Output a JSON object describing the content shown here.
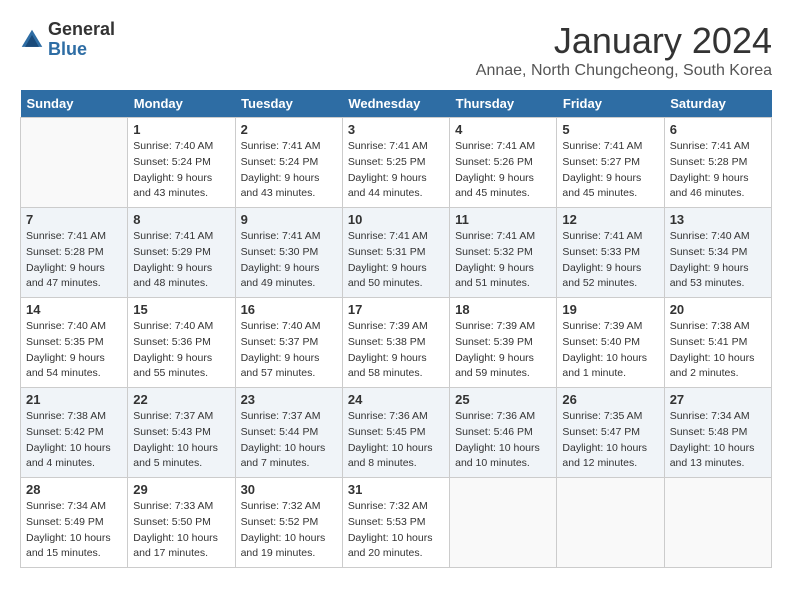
{
  "logo": {
    "general": "General",
    "blue": "Blue"
  },
  "title": "January 2024",
  "subtitle": "Annae, North Chungcheong, South Korea",
  "days_of_week": [
    "Sunday",
    "Monday",
    "Tuesday",
    "Wednesday",
    "Thursday",
    "Friday",
    "Saturday"
  ],
  "weeks": [
    [
      {
        "day": "",
        "info": ""
      },
      {
        "day": "1",
        "info": "Sunrise: 7:40 AM\nSunset: 5:24 PM\nDaylight: 9 hours\nand 43 minutes."
      },
      {
        "day": "2",
        "info": "Sunrise: 7:41 AM\nSunset: 5:24 PM\nDaylight: 9 hours\nand 43 minutes."
      },
      {
        "day": "3",
        "info": "Sunrise: 7:41 AM\nSunset: 5:25 PM\nDaylight: 9 hours\nand 44 minutes."
      },
      {
        "day": "4",
        "info": "Sunrise: 7:41 AM\nSunset: 5:26 PM\nDaylight: 9 hours\nand 45 minutes."
      },
      {
        "day": "5",
        "info": "Sunrise: 7:41 AM\nSunset: 5:27 PM\nDaylight: 9 hours\nand 45 minutes."
      },
      {
        "day": "6",
        "info": "Sunrise: 7:41 AM\nSunset: 5:28 PM\nDaylight: 9 hours\nand 46 minutes."
      }
    ],
    [
      {
        "day": "7",
        "info": "Sunrise: 7:41 AM\nSunset: 5:28 PM\nDaylight: 9 hours\nand 47 minutes."
      },
      {
        "day": "8",
        "info": "Sunrise: 7:41 AM\nSunset: 5:29 PM\nDaylight: 9 hours\nand 48 minutes."
      },
      {
        "day": "9",
        "info": "Sunrise: 7:41 AM\nSunset: 5:30 PM\nDaylight: 9 hours\nand 49 minutes."
      },
      {
        "day": "10",
        "info": "Sunrise: 7:41 AM\nSunset: 5:31 PM\nDaylight: 9 hours\nand 50 minutes."
      },
      {
        "day": "11",
        "info": "Sunrise: 7:41 AM\nSunset: 5:32 PM\nDaylight: 9 hours\nand 51 minutes."
      },
      {
        "day": "12",
        "info": "Sunrise: 7:41 AM\nSunset: 5:33 PM\nDaylight: 9 hours\nand 52 minutes."
      },
      {
        "day": "13",
        "info": "Sunrise: 7:40 AM\nSunset: 5:34 PM\nDaylight: 9 hours\nand 53 minutes."
      }
    ],
    [
      {
        "day": "14",
        "info": "Sunrise: 7:40 AM\nSunset: 5:35 PM\nDaylight: 9 hours\nand 54 minutes."
      },
      {
        "day": "15",
        "info": "Sunrise: 7:40 AM\nSunset: 5:36 PM\nDaylight: 9 hours\nand 55 minutes."
      },
      {
        "day": "16",
        "info": "Sunrise: 7:40 AM\nSunset: 5:37 PM\nDaylight: 9 hours\nand 57 minutes."
      },
      {
        "day": "17",
        "info": "Sunrise: 7:39 AM\nSunset: 5:38 PM\nDaylight: 9 hours\nand 58 minutes."
      },
      {
        "day": "18",
        "info": "Sunrise: 7:39 AM\nSunset: 5:39 PM\nDaylight: 9 hours\nand 59 minutes."
      },
      {
        "day": "19",
        "info": "Sunrise: 7:39 AM\nSunset: 5:40 PM\nDaylight: 10 hours\nand 1 minute."
      },
      {
        "day": "20",
        "info": "Sunrise: 7:38 AM\nSunset: 5:41 PM\nDaylight: 10 hours\nand 2 minutes."
      }
    ],
    [
      {
        "day": "21",
        "info": "Sunrise: 7:38 AM\nSunset: 5:42 PM\nDaylight: 10 hours\nand 4 minutes."
      },
      {
        "day": "22",
        "info": "Sunrise: 7:37 AM\nSunset: 5:43 PM\nDaylight: 10 hours\nand 5 minutes."
      },
      {
        "day": "23",
        "info": "Sunrise: 7:37 AM\nSunset: 5:44 PM\nDaylight: 10 hours\nand 7 minutes."
      },
      {
        "day": "24",
        "info": "Sunrise: 7:36 AM\nSunset: 5:45 PM\nDaylight: 10 hours\nand 8 minutes."
      },
      {
        "day": "25",
        "info": "Sunrise: 7:36 AM\nSunset: 5:46 PM\nDaylight: 10 hours\nand 10 minutes."
      },
      {
        "day": "26",
        "info": "Sunrise: 7:35 AM\nSunset: 5:47 PM\nDaylight: 10 hours\nand 12 minutes."
      },
      {
        "day": "27",
        "info": "Sunrise: 7:34 AM\nSunset: 5:48 PM\nDaylight: 10 hours\nand 13 minutes."
      }
    ],
    [
      {
        "day": "28",
        "info": "Sunrise: 7:34 AM\nSunset: 5:49 PM\nDaylight: 10 hours\nand 15 minutes."
      },
      {
        "day": "29",
        "info": "Sunrise: 7:33 AM\nSunset: 5:50 PM\nDaylight: 10 hours\nand 17 minutes."
      },
      {
        "day": "30",
        "info": "Sunrise: 7:32 AM\nSunset: 5:52 PM\nDaylight: 10 hours\nand 19 minutes."
      },
      {
        "day": "31",
        "info": "Sunrise: 7:32 AM\nSunset: 5:53 PM\nDaylight: 10 hours\nand 20 minutes."
      },
      {
        "day": "",
        "info": ""
      },
      {
        "day": "",
        "info": ""
      },
      {
        "day": "",
        "info": ""
      }
    ]
  ]
}
